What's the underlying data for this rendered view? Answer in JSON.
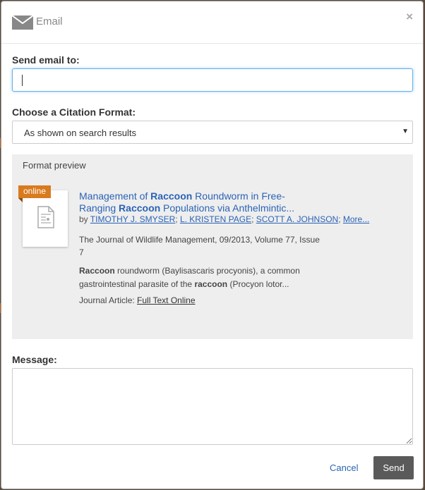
{
  "dialog": {
    "title": "Email",
    "close_label": "×",
    "header_icon": "envelope-icon"
  },
  "email": {
    "label": "Send email to:",
    "value": "",
    "placeholder": ""
  },
  "citation": {
    "label": "Choose a Citation Format:",
    "selected": "As shown on search results",
    "arrow": "▼"
  },
  "preview": {
    "title": "Format preview",
    "badge": "online",
    "record": {
      "title_parts": [
        "Management of ",
        "Raccoon",
        " Roundworm in Free-Ranging ",
        "Raccoon",
        " Populations via Anthelmintic..."
      ],
      "by": "by ",
      "authors": [
        "TIMOTHY J. SMYSER",
        "L. KRISTEN PAGE",
        "SCOTT A. JOHNSON"
      ],
      "more": "More...",
      "source": "The Journal of Wildlife Management, 09/2013, Volume 77, Issue 7",
      "snippet_parts": [
        "Raccoon",
        " roundworm (Baylisascaris procyonis), a common gastrointestinal parasite of the ",
        "raccoon",
        " (Procyon lotor..."
      ],
      "type_label": "Journal Article: ",
      "fulltext_link": "Full Text Online"
    }
  },
  "message": {
    "label": "Message:",
    "value": ""
  },
  "footer": {
    "cancel_label": "Cancel",
    "send_label": "Send"
  },
  "colors": {
    "link": "#2b63b6",
    "badge": "#d97a1e",
    "send_button": "#5a5a5a"
  }
}
